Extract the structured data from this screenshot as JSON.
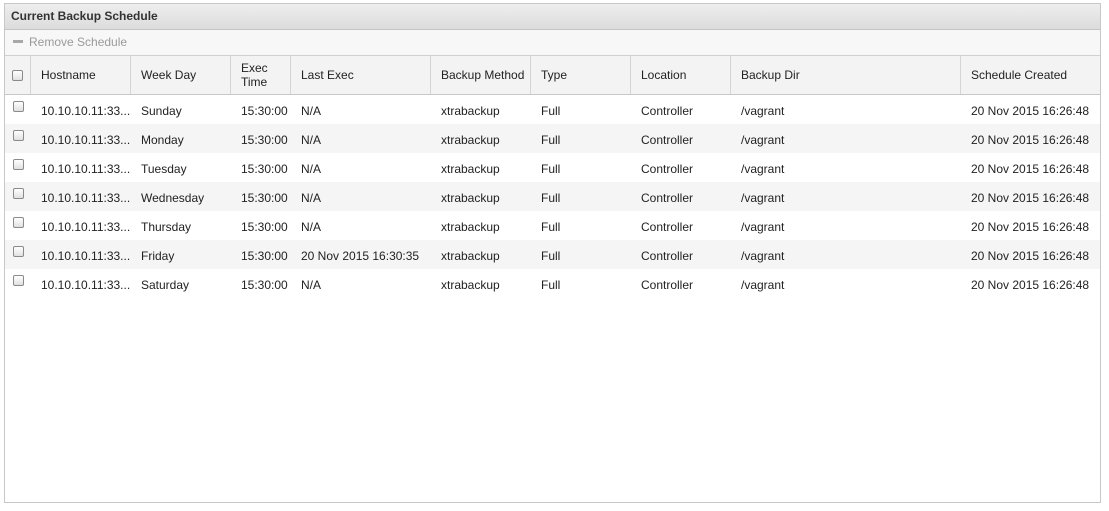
{
  "panel": {
    "title": "Current Backup Schedule",
    "toolbar": {
      "remove_label": "Remove Schedule"
    }
  },
  "columns": [
    "Hostname",
    "Week Day",
    "Exec Time",
    "Last Exec",
    "Backup Method",
    "Type",
    "Location",
    "Backup Dir",
    "Schedule Created"
  ],
  "rows": [
    {
      "hostname": "10.10.10.11:33...",
      "weekday": "Sunday",
      "exec_time": "15:30:00",
      "last_exec": "N/A",
      "method": "xtrabackup",
      "type": "Full",
      "location": "Controller",
      "dir": "/vagrant",
      "created": "20 Nov 2015 16:26:48"
    },
    {
      "hostname": "10.10.10.11:33...",
      "weekday": "Monday",
      "exec_time": "15:30:00",
      "last_exec": "N/A",
      "method": "xtrabackup",
      "type": "Full",
      "location": "Controller",
      "dir": "/vagrant",
      "created": "20 Nov 2015 16:26:48"
    },
    {
      "hostname": "10.10.10.11:33...",
      "weekday": "Tuesday",
      "exec_time": "15:30:00",
      "last_exec": "N/A",
      "method": "xtrabackup",
      "type": "Full",
      "location": "Controller",
      "dir": "/vagrant",
      "created": "20 Nov 2015 16:26:48"
    },
    {
      "hostname": "10.10.10.11:33...",
      "weekday": "Wednesday",
      "exec_time": "15:30:00",
      "last_exec": "N/A",
      "method": "xtrabackup",
      "type": "Full",
      "location": "Controller",
      "dir": "/vagrant",
      "created": "20 Nov 2015 16:26:48"
    },
    {
      "hostname": "10.10.10.11:33...",
      "weekday": "Thursday",
      "exec_time": "15:30:00",
      "last_exec": "N/A",
      "method": "xtrabackup",
      "type": "Full",
      "location": "Controller",
      "dir": "/vagrant",
      "created": "20 Nov 2015 16:26:48"
    },
    {
      "hostname": "10.10.10.11:33...",
      "weekday": "Friday",
      "exec_time": "15:30:00",
      "last_exec": "20 Nov 2015 16:30:35",
      "method": "xtrabackup",
      "type": "Full",
      "location": "Controller",
      "dir": "/vagrant",
      "created": "20 Nov 2015 16:26:48"
    },
    {
      "hostname": "10.10.10.11:33...",
      "weekday": "Saturday",
      "exec_time": "15:30:00",
      "last_exec": "N/A",
      "method": "xtrabackup",
      "type": "Full",
      "location": "Controller",
      "dir": "/vagrant",
      "created": "20 Nov 2015 16:26:48"
    }
  ]
}
